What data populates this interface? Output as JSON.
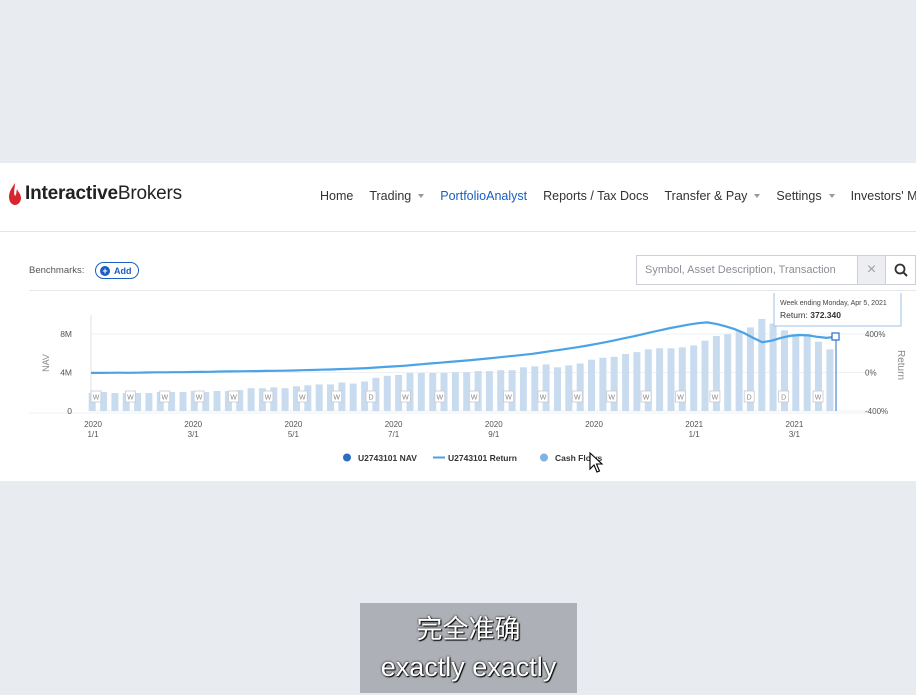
{
  "header": {
    "logo": {
      "part1": "Interactive",
      "part2": "Brokers",
      "brand_color": "#d8262f"
    },
    "nav": [
      {
        "label": "Home",
        "dropdown": false
      },
      {
        "label": "Trading",
        "dropdown": true
      },
      {
        "label": "PortfolioAnalyst",
        "dropdown": false,
        "active": true
      },
      {
        "label": "Reports / Tax Docs",
        "dropdown": false
      },
      {
        "label": "Transfer & Pay",
        "dropdown": true
      },
      {
        "label": "Settings",
        "dropdown": true
      },
      {
        "label": "Investors' Marketpla",
        "dropdown": false
      }
    ]
  },
  "toolbar": {
    "benchmarks_label": "Benchmarks:",
    "add_label": "Add",
    "search_placeholder": "Symbol, Asset Description, Transaction",
    "clear_icon": "close-icon",
    "search_icon": "search-icon"
  },
  "tooltip": {
    "line1": "Week ending Monday, Apr 5, 2021",
    "return_label": "Return:",
    "return_value": "372.340"
  },
  "legend": [
    {
      "label": "U2743101 NAV",
      "marker": "dot",
      "color": "#2a6fc4"
    },
    {
      "label": "U2743101 Return",
      "marker": "line",
      "color": "#4aa3e6"
    },
    {
      "label": "Cash Flows",
      "marker": "dot",
      "color": "#7fb2e0"
    }
  ],
  "colors": {
    "accent": "#1a5fbf",
    "return_line": "#4aa3e6",
    "bars": "#c9dcef"
  },
  "chart_data": {
    "type": "bar",
    "title": "",
    "ylabel": "NAV",
    "y2label": "Return",
    "y_ticks": [
      "8M",
      "4M",
      "0"
    ],
    "ylim": [
      0,
      10
    ],
    "y2_ticks": [
      "400%",
      "0%",
      "-400%"
    ],
    "y2lim": [
      -400,
      540
    ],
    "x_ticks": [
      {
        "year": "2020",
        "date": "1/1"
      },
      {
        "year": "2020",
        "date": "3/1"
      },
      {
        "year": "2020",
        "date": "5/1"
      },
      {
        "year": "2020",
        "date": "7/1"
      },
      {
        "year": "2020",
        "date": "9/1"
      },
      {
        "year": "2020",
        "date": ""
      },
      {
        "year": "2021",
        "date": "1/1"
      },
      {
        "year": "2021",
        "date": "3/1"
      }
    ],
    "series": [
      {
        "name": "U2743101 NAV",
        "unit": "M",
        "values": [
          1.9,
          2.0,
          1.9,
          1.9,
          1.9,
          1.9,
          2.0,
          2.0,
          2.0,
          2.1,
          2.0,
          2.1,
          2.1,
          2.2,
          2.4,
          2.4,
          2.5,
          2.4,
          2.6,
          2.7,
          2.8,
          2.8,
          3.0,
          2.9,
          3.1,
          3.5,
          3.7,
          3.8,
          4.0,
          4.0,
          4.0,
          4.0,
          4.1,
          4.1,
          4.2,
          4.2,
          4.3,
          4.3,
          4.6,
          4.7,
          4.9,
          4.6,
          4.8,
          5.0,
          5.4,
          5.6,
          5.7,
          6.0,
          6.2,
          6.5,
          6.6,
          6.6,
          6.7,
          6.9,
          7.4,
          7.9,
          8.1,
          8.4,
          8.8,
          9.7,
          9.2,
          8.5,
          8.1,
          8.1,
          7.3,
          6.5
        ]
      },
      {
        "name": "U2743101 Return",
        "unit": "%",
        "values": [
          -4,
          -4,
          -3,
          -2,
          -3,
          -2,
          0,
          2,
          2,
          3,
          3,
          5,
          6,
          7,
          10,
          11,
          12,
          14,
          15,
          17,
          18,
          19,
          21,
          24,
          26,
          29,
          31,
          35,
          38,
          42,
          46,
          52,
          58,
          63,
          70,
          78,
          86,
          95,
          102,
          110,
          118,
          126,
          135,
          144,
          154,
          164,
          174,
          184,
          194,
          208,
          222,
          236,
          250,
          264,
          280,
          298,
          316,
          336,
          356,
          376,
          398,
          420,
          440,
          462,
          480,
          498,
          512,
          520,
          505,
          480,
          450,
          410,
          360,
          315,
          330,
          360,
          380,
          390,
          385,
          370,
          360,
          372
        ]
      },
      {
        "name": "Cash Flows",
        "markers": [
          "W",
          "W",
          "W",
          "W",
          "W",
          "W",
          "W",
          "W",
          "D",
          "W",
          "W",
          "W",
          "W",
          "W",
          "W",
          "W",
          "W",
          "W",
          "W",
          "D",
          "D",
          "W"
        ]
      }
    ]
  },
  "cursor": "mouse-pointer",
  "subtitle": {
    "line1": "完全准确",
    "line2": "exactly exactly"
  }
}
